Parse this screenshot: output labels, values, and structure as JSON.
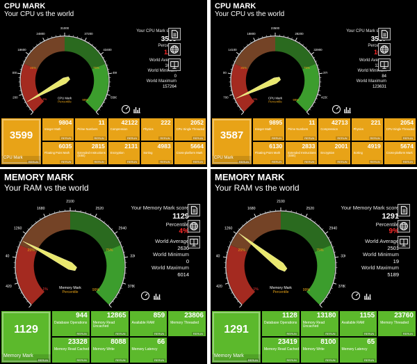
{
  "icons": {
    "doc": "document-icon",
    "globe": "globe-icon",
    "compare": "compare-icon",
    "gauge": "speedometer-icon",
    "chart": "bar-chart-icon"
  },
  "rerun_label": "RERUN",
  "panels": [
    {
      "type": "cpu",
      "title": "CPU MARK",
      "subtitle": "Your CPU vs the world",
      "gauge": {
        "max": 62000,
        "ticks": [
          "0",
          "6200",
          "12400",
          "18600",
          "24800",
          "31000",
          "37200",
          "43400",
          "49600",
          "55800",
          "62000"
        ],
        "percent_labels": [
          "1%",
          "25%",
          "75%",
          "99%"
        ],
        "percent_values": [
          1,
          25,
          75,
          99
        ],
        "needle": 3599,
        "name": "CPU Mark",
        "sub": "Percentile"
      },
      "score_label": "Your CPU Mark score",
      "score": "3599",
      "percentile_label": "Percentile",
      "percentile": "12%",
      "world_average_label": "World Average",
      "world_average": "16138",
      "world_minimum_label": "World Minimum",
      "world_minimum": "0",
      "world_maximum_label": "World Maximum",
      "world_maximum": "157264",
      "main_tile": {
        "value": "3599",
        "label": "CPU Mark"
      },
      "tiles": [
        {
          "value": "9804",
          "label": "Integer Math"
        },
        {
          "value": "11",
          "label": "Prime Numbers"
        },
        {
          "value": "42122",
          "label": "Compression"
        },
        {
          "value": "222",
          "label": "Physics"
        },
        {
          "value": "2052",
          "label": "CPU Single Threaded"
        },
        {
          "value": "6035",
          "label": "Floating Point Math"
        },
        {
          "value": "2815",
          "label": "Extended Instructions (SSE)"
        },
        {
          "value": "2131",
          "label": "Encryption"
        },
        {
          "value": "4983",
          "label": "Sorting"
        },
        {
          "value": "5664",
          "label": "Cross-platform Mark"
        }
      ]
    },
    {
      "type": "cpu",
      "title": "CPU MARK",
      "subtitle": "Your CPU vs the world",
      "gauge": {
        "max": 47000,
        "ticks": [
          "0",
          "4700",
          "9400",
          "14100",
          "18800",
          "23500",
          "28200",
          "32900",
          "37600",
          "42300",
          "47000"
        ],
        "percent_labels": [
          "1%",
          "25%",
          "75%",
          "99%"
        ],
        "percent_values": [
          1,
          25,
          75,
          99
        ],
        "needle": 3587,
        "name": "CPU Mark",
        "sub": "Percentile"
      },
      "score_label": "Your CPU Mark score",
      "score": "3587",
      "percentile_label": "Percentile",
      "percentile": "16%",
      "world_average_label": "World Average",
      "world_average": "12449",
      "world_minimum_label": "World Minimum",
      "world_minimum": "84",
      "world_maximum_label": "World Maximum",
      "world_maximum": "123631",
      "main_tile": {
        "value": "3587",
        "label": "CPU Mark"
      },
      "tiles": [
        {
          "value": "9895",
          "label": "Integer Math"
        },
        {
          "value": "11",
          "label": "Prime Numbers"
        },
        {
          "value": "42713",
          "label": "Compression"
        },
        {
          "value": "221",
          "label": "Physics"
        },
        {
          "value": "2054",
          "label": "CPU Single Threaded"
        },
        {
          "value": "6130",
          "label": "Floating Point Math"
        },
        {
          "value": "2833",
          "label": "Extended Instructions (SSE)"
        },
        {
          "value": "2001",
          "label": "Encryption"
        },
        {
          "value": "4919",
          "label": "Sorting"
        },
        {
          "value": "5674",
          "label": "Cross-platform Mark"
        }
      ]
    },
    {
      "type": "mem",
      "title": "MEMORY MARK",
      "subtitle": "Your RAM vs the world",
      "gauge": {
        "max": 4200,
        "ticks": [
          "0",
          "420",
          "840",
          "1260",
          "1680",
          "2100",
          "2520",
          "2940",
          "3360",
          "3780",
          "4200"
        ],
        "percent_labels": [
          "1%",
          "25%",
          "75%",
          "99%"
        ],
        "percent_values": [
          1,
          25,
          75,
          99
        ],
        "needle": 1129,
        "name": "Memory Mark",
        "sub": "Percentile"
      },
      "score_label": "Your Memory Mark score",
      "score": "1129",
      "percentile_label": "Percentile",
      "percentile": "4%",
      "world_average_label": "World Average",
      "world_average": "2630",
      "world_minimum_label": "World Minimum",
      "world_minimum": "0",
      "world_maximum_label": "World Maximum",
      "world_maximum": "6014",
      "main_tile": {
        "value": "1129",
        "label": "Memory Mark"
      },
      "tiles": [
        {
          "value": "944",
          "label": "Database Operations"
        },
        {
          "value": "12865",
          "label": "Memory Read Uncached"
        },
        {
          "value": "859",
          "label": "Available RAM"
        },
        {
          "value": "23806",
          "label": "Memory Threaded"
        },
        {
          "value": "23328",
          "label": "Memory Read Cached"
        },
        {
          "value": "8088",
          "label": "Memory Write"
        },
        {
          "value": "66",
          "label": "Memory Latency"
        }
      ]
    },
    {
      "type": "mem",
      "title": "MEMORY MARK",
      "subtitle": "Your RAM vs the world",
      "gauge": {
        "max": 4200,
        "ticks": [
          "0",
          "420",
          "840",
          "1260",
          "1680",
          "2100",
          "2520",
          "2940",
          "3360",
          "3780",
          "4200"
        ],
        "percent_labels": [
          "1%",
          "25%",
          "75%",
          "99%"
        ],
        "percent_values": [
          1,
          25,
          75,
          99
        ],
        "needle": 1291,
        "name": "Memory Mark",
        "sub": "Percentile"
      },
      "score_label": "Your Memory Mark score",
      "score": "1291",
      "percentile_label": "Percentile",
      "percentile": "9%",
      "world_average_label": "World Average",
      "world_average": "2501",
      "world_minimum_label": "World Minimum",
      "world_minimum": "19",
      "world_maximum_label": "World Maximum",
      "world_maximum": "5189",
      "main_tile": {
        "value": "1291",
        "label": "Memory Mark"
      },
      "tiles": [
        {
          "value": "1128",
          "label": "Database Operations"
        },
        {
          "value": "13180",
          "label": "Memory Read Uncached"
        },
        {
          "value": "1155",
          "label": "Available RAM"
        },
        {
          "value": "23760",
          "label": "Memory Threaded"
        },
        {
          "value": "23419",
          "label": "Memory Read Cached"
        },
        {
          "value": "8100",
          "label": "Memory Write"
        },
        {
          "value": "65",
          "label": "Memory Latency"
        }
      ]
    }
  ]
}
